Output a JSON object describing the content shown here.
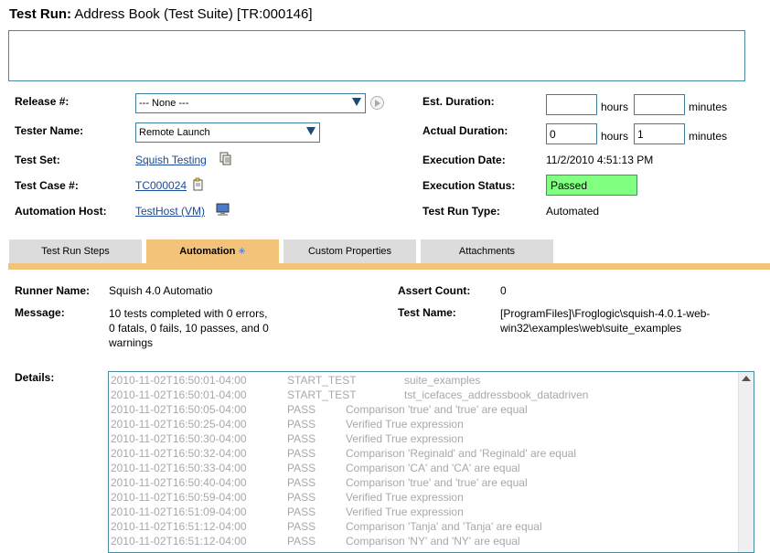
{
  "page": {
    "title_label": "Test Run:",
    "title_value": "Address Book (Test Suite) [TR:000146]"
  },
  "fields": {
    "release_label": "Release #:",
    "release_value": "--- None ---",
    "tester_label": "Tester Name:",
    "tester_value": "Remote Launch",
    "test_set_label": "Test Set:",
    "test_set_value": "Squish Testing",
    "test_case_label": "Test Case #:",
    "test_case_value": "TC000024",
    "host_label": "Automation Host:",
    "host_value": "TestHost (VM)",
    "est_duration_label": "Est. Duration:",
    "est_hours_value": "",
    "est_minutes_value": "",
    "actual_duration_label": "Actual Duration:",
    "actual_hours_value": "0",
    "actual_minutes_value": "1",
    "hours_unit": "hours",
    "minutes_unit": "minutes",
    "exec_date_label": "Execution Date:",
    "exec_date_value": "11/2/2010 4:51:13 PM",
    "exec_status_label": "Execution Status:",
    "exec_status_value": "Passed",
    "run_type_label": "Test Run Type:",
    "run_type_value": "Automated"
  },
  "tabs": [
    {
      "label": "Test Run Steps"
    },
    {
      "label": "Automation",
      "marker": "✳"
    },
    {
      "label": "Custom Properties"
    },
    {
      "label": "Attachments"
    }
  ],
  "automation": {
    "runner_label": "Runner Name:",
    "runner_value": "Squish 4.0 Automatio",
    "message_label": "Message:",
    "message_line1": "10 tests completed with 0 errors,",
    "message_line2": "0 fatals, 0 fails, 10 passes, and 0",
    "message_line3": "warnings",
    "assert_label": "Assert Count:",
    "assert_value": "0",
    "test_name_label": "Test Name:",
    "test_name_line1": "[ProgramFiles]\\Froglogic\\squish-4.0.1-web-",
    "test_name_line2": "win32\\examples\\web\\suite_examples",
    "details_label": "Details:"
  },
  "log": [
    {
      "time": "2010-11-02T16:50:01-04:00",
      "type": "START_TEST",
      "msg": "suite_examples"
    },
    {
      "time": "2010-11-02T16:50:01-04:00",
      "type": "START_TEST",
      "msg": "tst_icefaces_addressbook_datadriven"
    },
    {
      "time": "2010-11-02T16:50:05-04:00",
      "type": "PASS",
      "msg": "Comparison 'true' and 'true' are equal"
    },
    {
      "time": "2010-11-02T16:50:25-04:00",
      "type": "PASS",
      "msg": "Verified True expression"
    },
    {
      "time": "2010-11-02T16:50:30-04:00",
      "type": "PASS",
      "msg": "Verified True expression"
    },
    {
      "time": "2010-11-02T16:50:32-04:00",
      "type": "PASS",
      "msg": "Comparison 'Reginald' and 'Reginald' are equal"
    },
    {
      "time": "2010-11-02T16:50:33-04:00",
      "type": "PASS",
      "msg": "Comparison 'CA' and 'CA' are equal"
    },
    {
      "time": "2010-11-02T16:50:40-04:00",
      "type": "PASS",
      "msg": "Comparison 'true' and 'true' are equal"
    },
    {
      "time": "2010-11-02T16:50:59-04:00",
      "type": "PASS",
      "msg": "Verified True expression"
    },
    {
      "time": "2010-11-02T16:51:09-04:00",
      "type": "PASS",
      "msg": "Verified True expression"
    },
    {
      "time": "2010-11-02T16:51:12-04:00",
      "type": "PASS",
      "msg": "Comparison 'Tanja' and 'Tanja' are equal"
    },
    {
      "time": "2010-11-02T16:51:12-04:00",
      "type": "PASS",
      "msg": "Comparison 'NY' and 'NY' are equal"
    }
  ],
  "colors": {
    "active_tab": "#f4c37a",
    "status_passed": "#80ff80",
    "link": "#1a4a9a",
    "border": "#3e7fa0"
  }
}
